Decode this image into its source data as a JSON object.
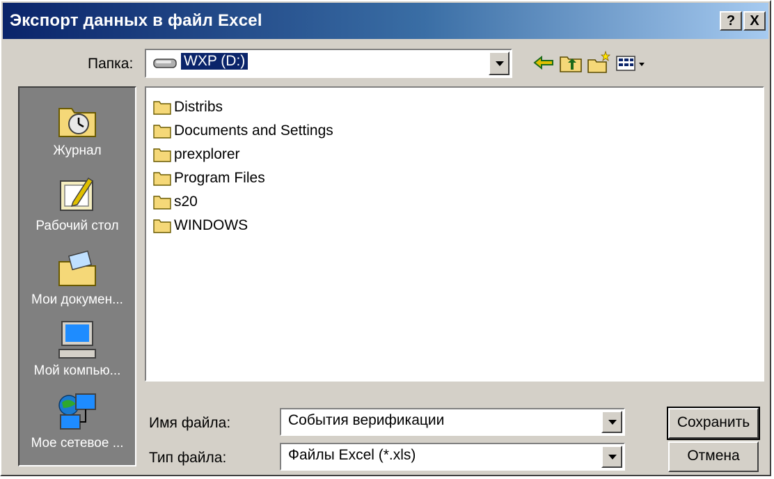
{
  "window": {
    "title": "Экспорт данных в файл Excel",
    "help_label": "?",
    "close_label": "X"
  },
  "lookin": {
    "label": "Папка:",
    "value": "WXP (D:)"
  },
  "toolbar": {
    "back_icon": "back-arrow-icon",
    "up_icon": "up-folder-icon",
    "new_folder_icon": "new-folder-icon",
    "views_icon": "views-menu-icon"
  },
  "places": [
    {
      "label": "Журнал",
      "icon": "history-icon"
    },
    {
      "label": "Рабочий стол",
      "icon": "desktop-icon"
    },
    {
      "label": "Мои докумен...",
      "icon": "my-documents-icon"
    },
    {
      "label": "Мой компью...",
      "icon": "my-computer-icon"
    },
    {
      "label": "Мое сетевое ...",
      "icon": "network-places-icon"
    }
  ],
  "files": [
    {
      "name": "Distribs"
    },
    {
      "name": "Documents and Settings"
    },
    {
      "name": "prexplorer"
    },
    {
      "name": "Program Files"
    },
    {
      "name": "s20"
    },
    {
      "name": "WINDOWS"
    }
  ],
  "filename": {
    "label": "Имя файла:",
    "value": "События верификации"
  },
  "filetype": {
    "label": "Тип файла:",
    "value": "Файлы Excel (*.xls)"
  },
  "buttons": {
    "save": "Сохранить",
    "cancel": "Отмена"
  },
  "colors": {
    "title_start": "#0a246a",
    "title_end": "#a6caf0",
    "face": "#d4d0c8",
    "selection": "#0a246a",
    "folder": "#f5d878"
  }
}
